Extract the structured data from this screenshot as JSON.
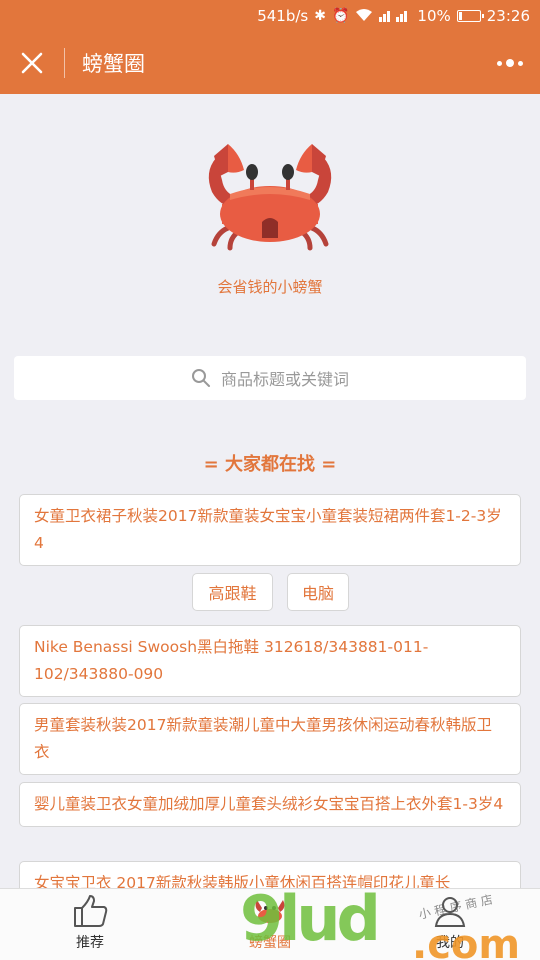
{
  "status_bar": {
    "network_speed": "541b/s",
    "battery": "10%",
    "time": "23:26"
  },
  "nav": {
    "title": "螃蟹圈"
  },
  "brand": {
    "slogan": "会省钱的小螃蟹"
  },
  "search": {
    "placeholder": "商品标题或关键词"
  },
  "section": {
    "title": "= 大家都在找 ="
  },
  "items": [
    {
      "text": "女童卫衣裙子秋装2017新款童装女宝宝小童套装短裙两件套1-2-3岁4"
    },
    {
      "text": "Nike Benassi Swoosh黑白拖鞋 312618/343881-011-102/343880-090"
    },
    {
      "text": "男童套装秋装2017新款童装潮儿童中大童男孩休闲运动春秋韩版卫衣"
    },
    {
      "text": "婴儿童装卫衣女童加绒加厚儿童套头绒衫女宝宝百搭上衣外套1-3岁4"
    },
    {
      "text": "女宝宝卫衣 2017新款秋装韩版小童休闲百搭连帽印花儿童长"
    }
  ],
  "tags": [
    {
      "label": "高跟鞋"
    },
    {
      "label": "电脑"
    }
  ],
  "tabs": [
    {
      "label": "推荐",
      "icon": "thumbs-up-icon"
    },
    {
      "label": "螃蟹圈",
      "icon": "crab-icon"
    },
    {
      "label": "我的",
      "icon": "user-icon"
    }
  ],
  "watermark": {
    "text": "9lud",
    "suffix": ".com",
    "caption": "小 程 序 商 店"
  },
  "colors": {
    "accent": "#e2763c",
    "background": "#efeff4"
  }
}
